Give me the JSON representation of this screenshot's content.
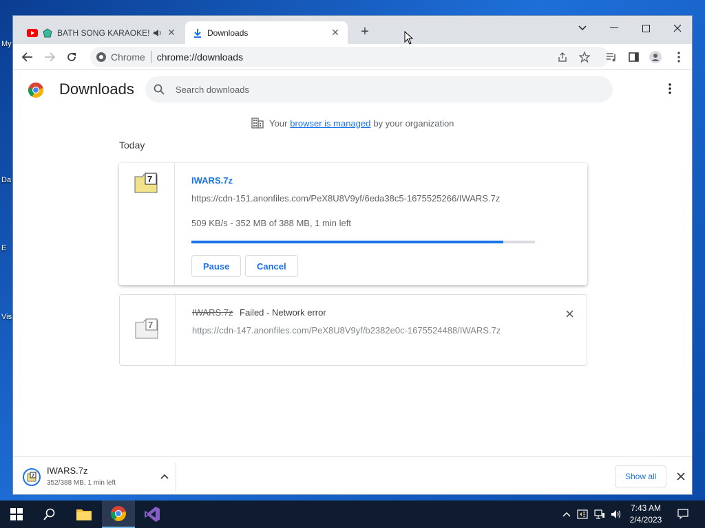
{
  "desktop": {
    "labels": [
      "My",
      "Da",
      "E",
      "Vis"
    ]
  },
  "tabs": [
    {
      "title": "BATH SONG KARAOKE!",
      "active": false
    },
    {
      "title": "Downloads",
      "active": true
    }
  ],
  "toolbar": {
    "omnibox_site": "Chrome",
    "omnibox_url": "chrome://downloads"
  },
  "page": {
    "title": "Downloads",
    "search_placeholder": "Search downloads",
    "managed_prefix": "Your",
    "managed_link": "browser is managed",
    "managed_suffix": "by your organization",
    "section_label": "Today"
  },
  "downloads": [
    {
      "filename": "IWARS.7z",
      "url": "https://cdn-151.anonfiles.com/PeX8U8V9yf/6eda38c5-1675525266/IWARS.7z",
      "status": "509 KB/s - 352 MB of 388 MB, 1 min left",
      "progress_percent": 90.7,
      "pause_label": "Pause",
      "cancel_label": "Cancel"
    },
    {
      "filename": "IWARS.7z",
      "status": "Failed - Network error",
      "url": "https://cdn-147.anonfiles.com/PeX8U8V9yf/b2382e0c-1675524488/IWARS.7z"
    }
  ],
  "shelf": {
    "filename": "IWARS.7z",
    "status": "352/388 MB, 1 min left",
    "show_all_label": "Show all"
  },
  "taskbar": {
    "time": "7:43 AM",
    "date": "2/4/2023"
  },
  "colors": {
    "accent": "#1a73e8",
    "taskbar": "#0f1b2e"
  }
}
